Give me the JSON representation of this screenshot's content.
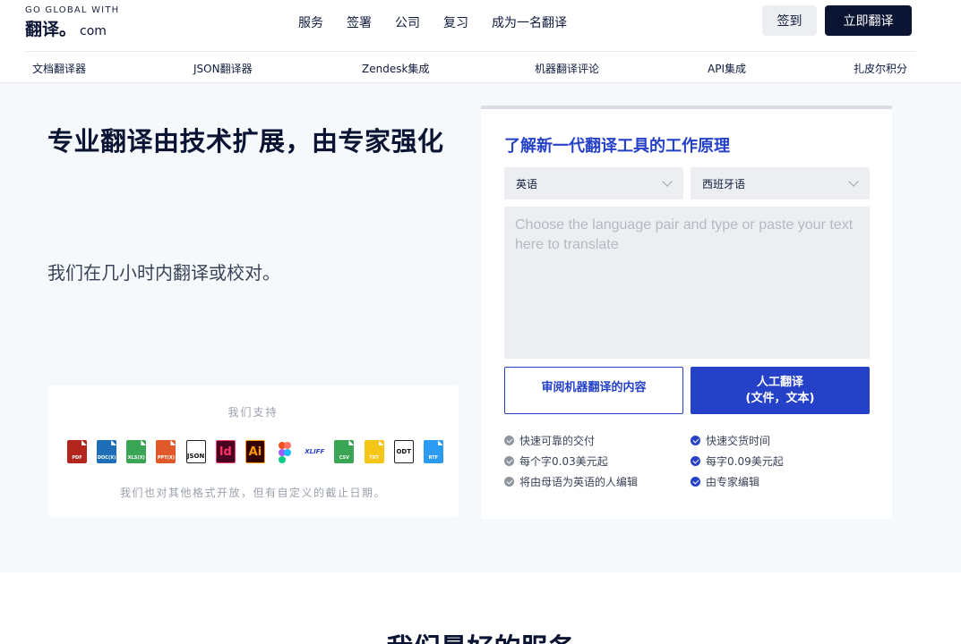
{
  "header": {
    "logo_top": "GO GLOBAL WITH",
    "logo_cn": "翻译",
    "logo_dot": "。",
    "logo_com": "com",
    "nav": [
      "服务",
      "签署",
      "公司",
      "复习",
      "成为一名翻译"
    ],
    "login_label": "签到",
    "translate_label": "立即翻译"
  },
  "subnav": [
    "文档翻译器",
    "JSON翻译器",
    "Zendesk集成",
    "机器翻译评论",
    "API集成",
    "扎皮尔积分"
  ],
  "hero": {
    "title": "专业翻译由技术扩展，由专家强化",
    "subtitle": "我们在几小时内翻译或校对。",
    "support_title": "我们支持",
    "support_note": "我们也对其他格式开放，但有自定义的截止日期。",
    "file_formats": [
      {
        "label": "PDF",
        "icon": "pdf-file-icon",
        "color": "#b3261e"
      },
      {
        "label": "DOC(X)",
        "icon": "doc-file-icon",
        "color": "#1e6fb8"
      },
      {
        "label": "XLS(X)",
        "icon": "xls-file-icon",
        "color": "#3aa655"
      },
      {
        "label": "PPT(X)",
        "icon": "ppt-file-icon",
        "color": "#e0592a"
      },
      {
        "label": "JSON",
        "icon": "json-file-icon",
        "color": "#ffffff"
      },
      {
        "label": "Id",
        "icon": "indesign-icon",
        "color": "#49021f"
      },
      {
        "label": "Ai",
        "icon": "illustrator-icon",
        "color": "#330000"
      },
      {
        "label": "",
        "icon": "figma-icon",
        "color": "#ffffff"
      },
      {
        "label": "XLIFF",
        "icon": "xliff-icon",
        "color": "#ffffff"
      },
      {
        "label": "CSV",
        "icon": "csv-file-icon",
        "color": "#3aa655"
      },
      {
        "label": "TXT",
        "icon": "txt-file-icon",
        "color": "#f5c518"
      },
      {
        "label": "ODT",
        "icon": "odt-file-icon",
        "color": "#ffffff"
      },
      {
        "label": "RTF",
        "icon": "rtf-file-icon",
        "color": "#2b9af3"
      }
    ]
  },
  "card": {
    "title": "了解新一代翻译工具的工作原理",
    "source_lang": "英语",
    "target_lang": "西班牙语",
    "placeholder": "Choose the language pair and type or paste your text here to translate",
    "review_label": "审阅机器翻译的内容",
    "human_label_1": "人工翻译",
    "human_label_2": "(文件，文本)",
    "features_left": [
      "快速可靠的交付",
      "每个字0.03美元起",
      "将由母语为英语的人编辑"
    ],
    "features_right": [
      "快速交货时间",
      "每字0.09美元起",
      "由专家编辑"
    ]
  },
  "section": {
    "title": "我们最好的服务"
  },
  "colors": {
    "accent": "#2541c8",
    "dark": "#0b1533",
    "hero_bg": "#f6f9fc"
  }
}
